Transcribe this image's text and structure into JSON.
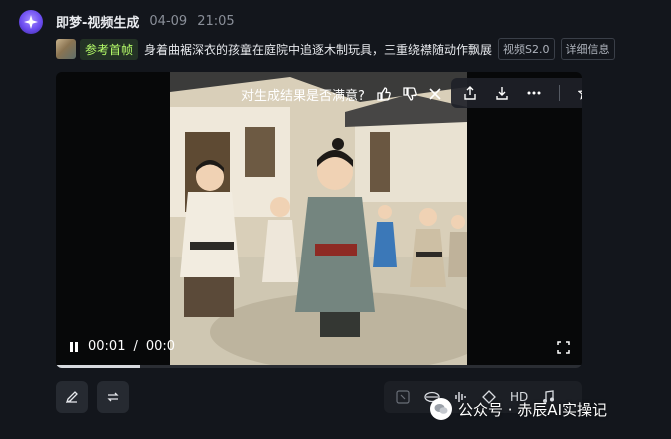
{
  "header": {
    "title": "即梦-视频生成",
    "date": "04-09",
    "time": "21:05"
  },
  "prompt": {
    "reference_label": "参考首帧",
    "text": "身着曲裾深衣的孩童在庭院中追逐木制玩具，三重绕襟随动作飘展",
    "model_badge": "视频S2.0",
    "details_button": "详细信息"
  },
  "video": {
    "feedback_question": "对生成结果是否满意?",
    "current_time": "00:01",
    "separator": "/",
    "duration_visible": "00:0",
    "progress_fraction": 0.16,
    "playing": true
  },
  "toolbar_icons": [
    "share-icon",
    "download-icon",
    "more-icon",
    "star-icon"
  ],
  "bottom_tools": {
    "hd_label": "HD"
  },
  "watermark": {
    "text": "公众号 · 赤辰AI实操记"
  },
  "colors": {
    "background": "#13161c",
    "accent_green": "#b7ff6a",
    "avatar_purple": "#6b4cf0"
  }
}
